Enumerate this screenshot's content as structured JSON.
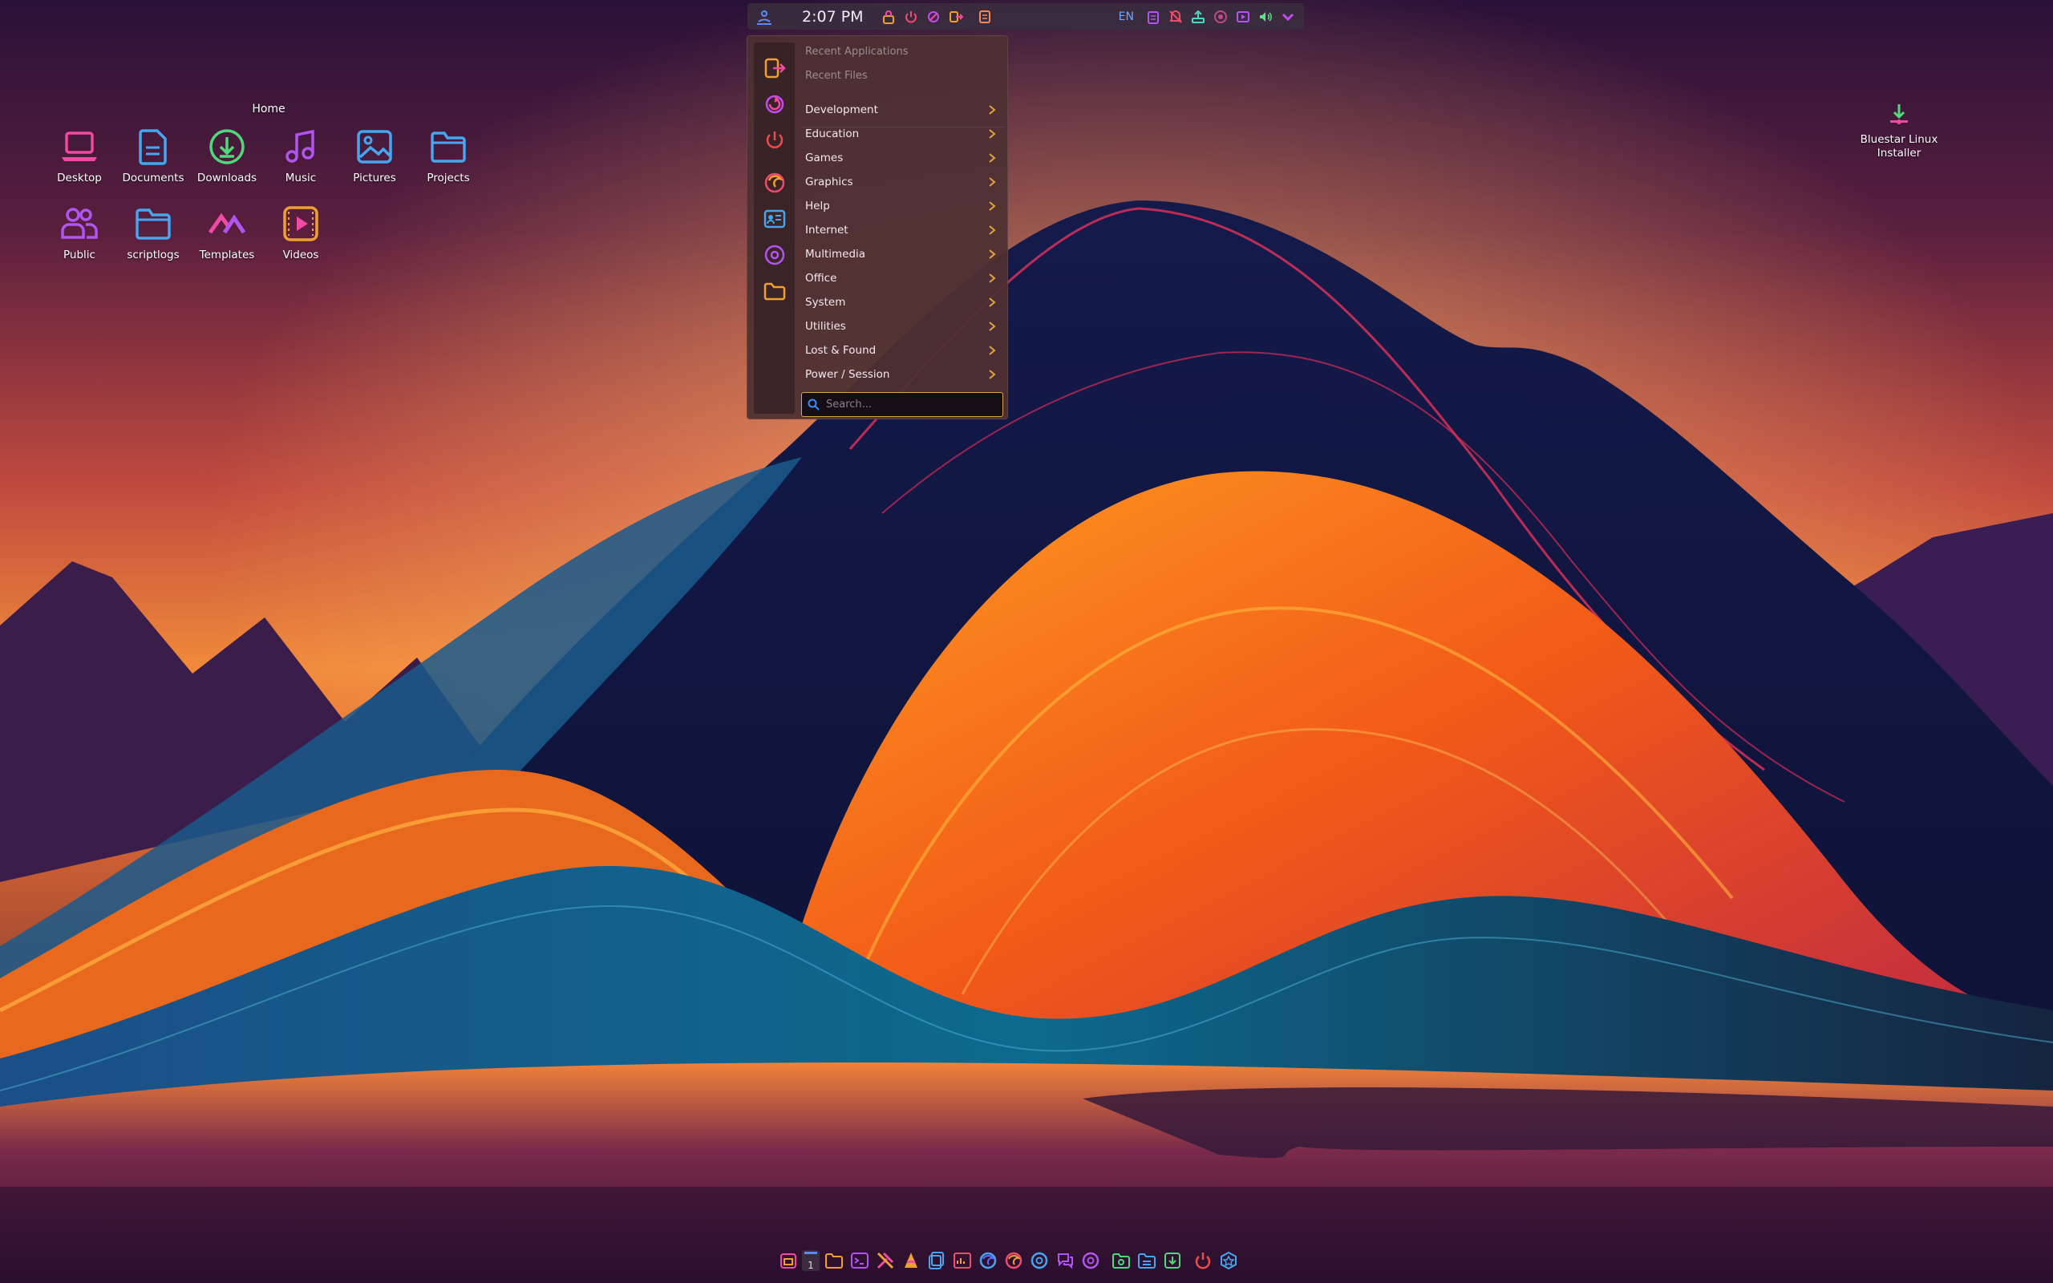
{
  "panel": {
    "clock": "2:07 PM",
    "language": "EN",
    "tray_left": [
      "lock-icon",
      "power-icon",
      "refresh-icon",
      "logout-icon"
    ],
    "tray_right": [
      "clipboard-icon",
      "mute-icon",
      "network-icon",
      "theme-icon",
      "media-icon",
      "volume-icon",
      "chevron-down-icon"
    ]
  },
  "start_menu": {
    "recent_applications": "Recent Applications",
    "recent_files": "Recent Files",
    "categories": [
      "Development",
      "Education",
      "Games",
      "Graphics",
      "Help",
      "Internet",
      "Multimedia",
      "Office",
      "System",
      "Utilities",
      "Lost & Found",
      "Power / Session"
    ],
    "search_placeholder": "Search..."
  },
  "desktop": {
    "home_label": "Home",
    "icons": [
      "Desktop",
      "Documents",
      "Downloads",
      "Music",
      "Pictures",
      "Projects",
      "Public",
      "scriptlogs",
      "Templates",
      "Videos"
    ],
    "installer_line1": "Bluestar Linux",
    "installer_line2": "Installer"
  },
  "dock": {
    "workspace": "1"
  },
  "colors": {
    "pink": "#f04ba4",
    "blue": "#46a6f0",
    "green": "#4fd97a",
    "purple": "#b155f0",
    "orange": "#f0a030",
    "accent_search": "#e0a443"
  }
}
